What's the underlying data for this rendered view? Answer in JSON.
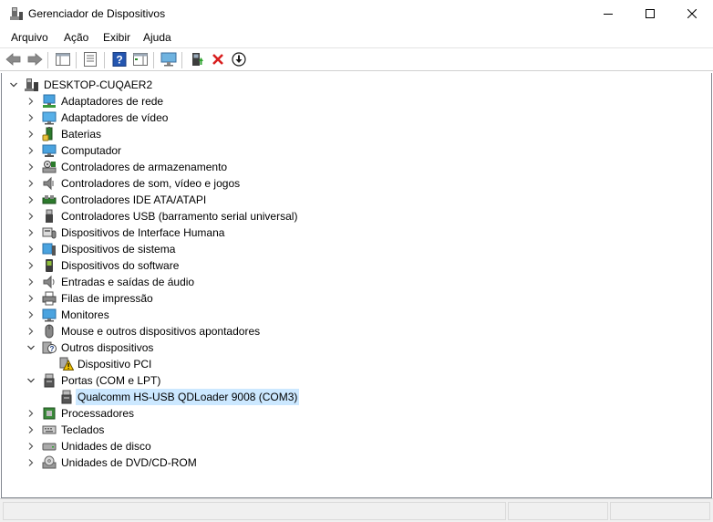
{
  "window": {
    "title": "Gerenciador de Dispositivos",
    "icon": "device-manager-icon",
    "controls": [
      "minimize-icon",
      "maximize-icon",
      "close-icon"
    ]
  },
  "menu": {
    "file": "Arquivo",
    "action": "Ação",
    "view": "Exibir",
    "help": "Ajuda"
  },
  "toolbar": {
    "buttons": [
      "back-arrow-icon",
      "forward-arrow-icon",
      "show-hide-console-tree-icon",
      "properties-icon",
      "help-icon",
      "action-pane-icon",
      "monitor-icon",
      "update-driver-icon",
      "uninstall-x-icon",
      "download-circle-icon"
    ]
  },
  "tree": {
    "root": "DESKTOP-CUQAER2",
    "categories": [
      {
        "label": "Adaptadores de rede",
        "icon": "network-adapter-icon"
      },
      {
        "label": "Adaptadores de vídeo",
        "icon": "display-adapter-icon"
      },
      {
        "label": "Baterias",
        "icon": "battery-icon"
      },
      {
        "label": "Computador",
        "icon": "computer-icon"
      },
      {
        "label": "Controladores de armazenamento",
        "icon": "storage-controller-icon"
      },
      {
        "label": "Controladores de som, vídeo e jogos",
        "icon": "sound-icon"
      },
      {
        "label": "Controladores IDE ATA/ATAPI",
        "icon": "ide-icon"
      },
      {
        "label": "Controladores USB (barramento serial universal)",
        "icon": "usb-icon"
      },
      {
        "label": "Dispositivos de Interface Humana",
        "icon": "hid-icon"
      },
      {
        "label": "Dispositivos de sistema",
        "icon": "system-device-icon"
      },
      {
        "label": "Dispositivos do software",
        "icon": "software-device-icon"
      },
      {
        "label": "Entradas e saídas de áudio",
        "icon": "audio-io-icon"
      },
      {
        "label": "Filas de impressão",
        "icon": "printer-icon"
      },
      {
        "label": "Monitores",
        "icon": "monitor-icon"
      },
      {
        "label": "Mouse e outros dispositivos apontadores",
        "icon": "mouse-icon"
      },
      {
        "label": "Outros dispositivos",
        "icon": "unknown-device-icon",
        "expanded": true,
        "children": [
          {
            "label": "Dispositivo PCI",
            "icon": "warning-device-icon"
          }
        ]
      },
      {
        "label": "Portas (COM e LPT)",
        "icon": "port-icon",
        "expanded": true,
        "children": [
          {
            "label": "Qualcomm HS-USB QDLoader 9008 (COM3)",
            "icon": "port-icon",
            "selected": true
          }
        ]
      },
      {
        "label": "Processadores",
        "icon": "processor-icon"
      },
      {
        "label": "Teclados",
        "icon": "keyboard-icon"
      },
      {
        "label": "Unidades de disco",
        "icon": "disk-drive-icon"
      },
      {
        "label": "Unidades de DVD/CD-ROM",
        "icon": "dvd-icon"
      }
    ]
  }
}
